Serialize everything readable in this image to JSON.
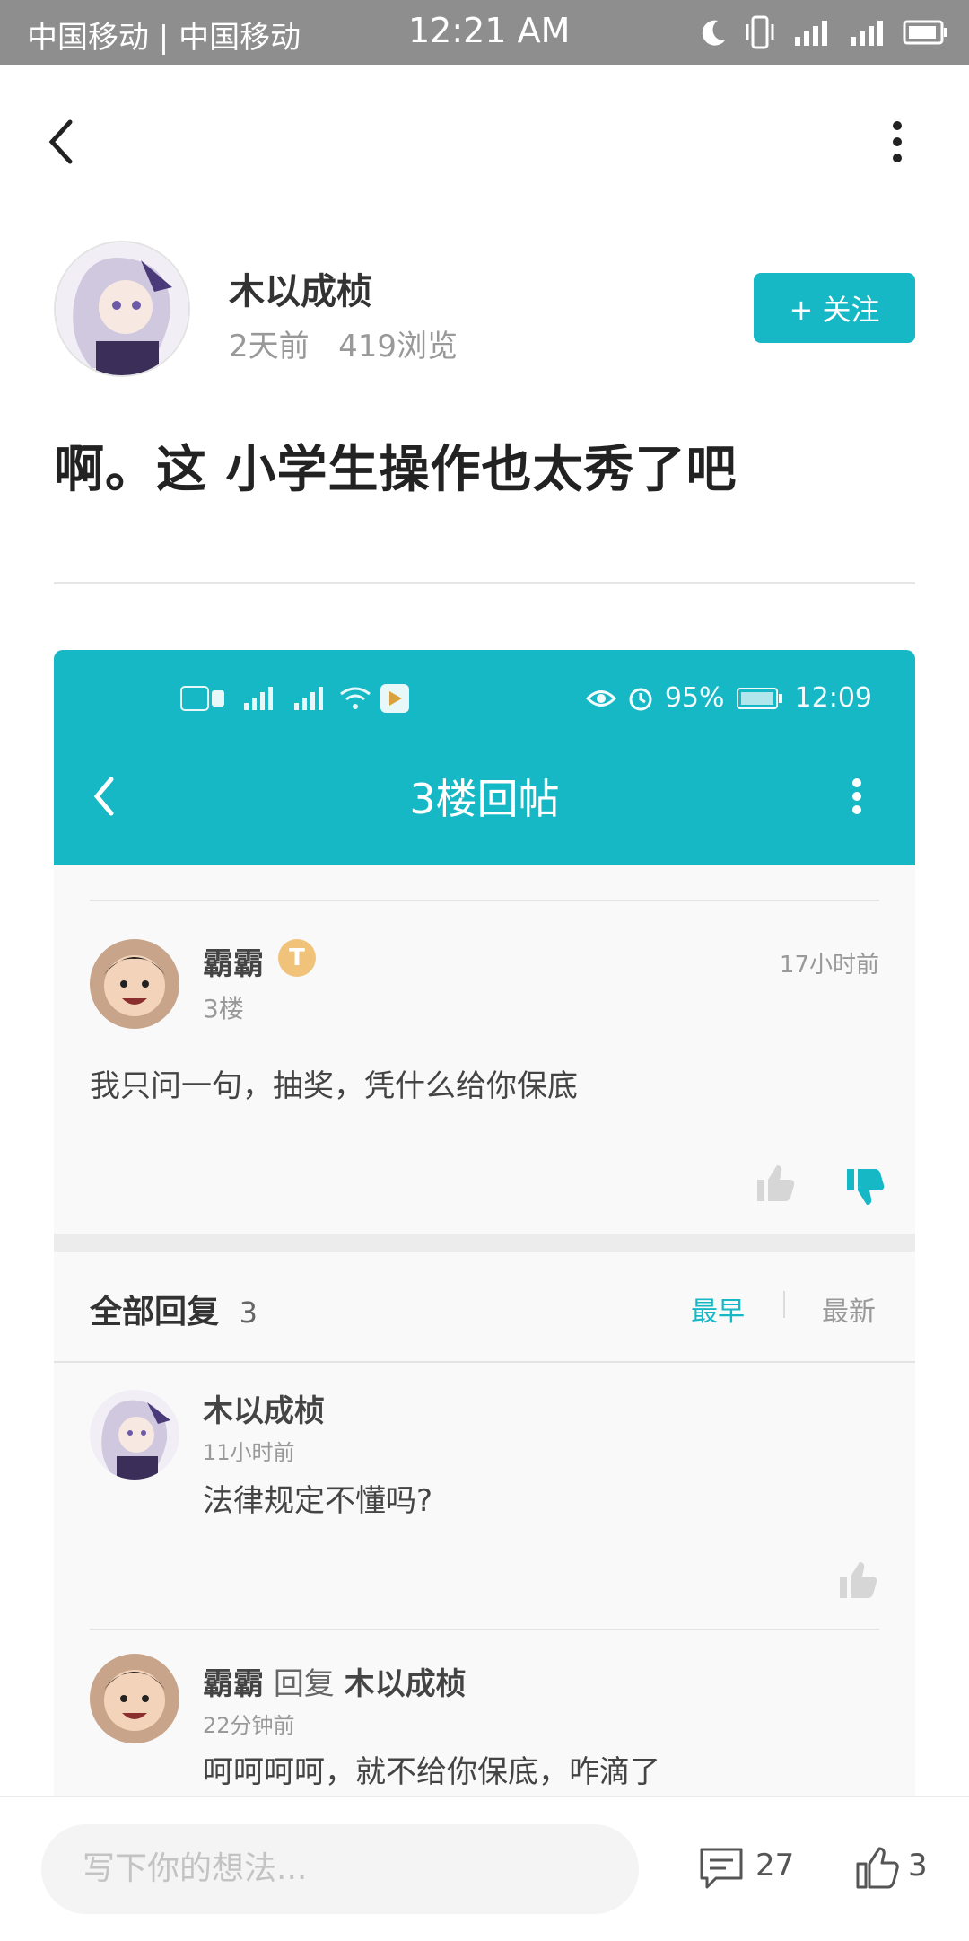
{
  "status_bar": {
    "carrier": "中国移动 | 中国移动",
    "time": "12:21 AM"
  },
  "post": {
    "author": "木以成桢",
    "posted": "2天前",
    "views": "419浏览",
    "follow_label": "+ 关注",
    "title": "啊。这  小学生操作也太秀了吧"
  },
  "screenshot": {
    "status_right_battery": "95%",
    "status_right_time": "12:09",
    "header_title": "3楼回帖",
    "floor_post": {
      "user": "霸霸",
      "badge": "T",
      "floor": "3楼",
      "time": "17小时前",
      "content": "我只问一句，抽奖，凭什么给你保底"
    },
    "replies_header": {
      "label": "全部回复",
      "count": "3",
      "sort_earliest": "最早",
      "sort_newest": "最新"
    },
    "replies": [
      {
        "user": "木以成桢",
        "time": "11小时前",
        "content": "法律规定不懂吗?"
      },
      {
        "user": "霸霸",
        "reply_word": "回复",
        "reply_to": "木以成桢",
        "time": "22分钟前",
        "content": "呵呵呵呵，就不给你保底，咋滴了"
      }
    ]
  },
  "bottom_bar": {
    "input_placeholder": "写下你的想法...",
    "comment_count": "27",
    "like_count": "3"
  },
  "colors": {
    "accent": "#17b8c6"
  }
}
